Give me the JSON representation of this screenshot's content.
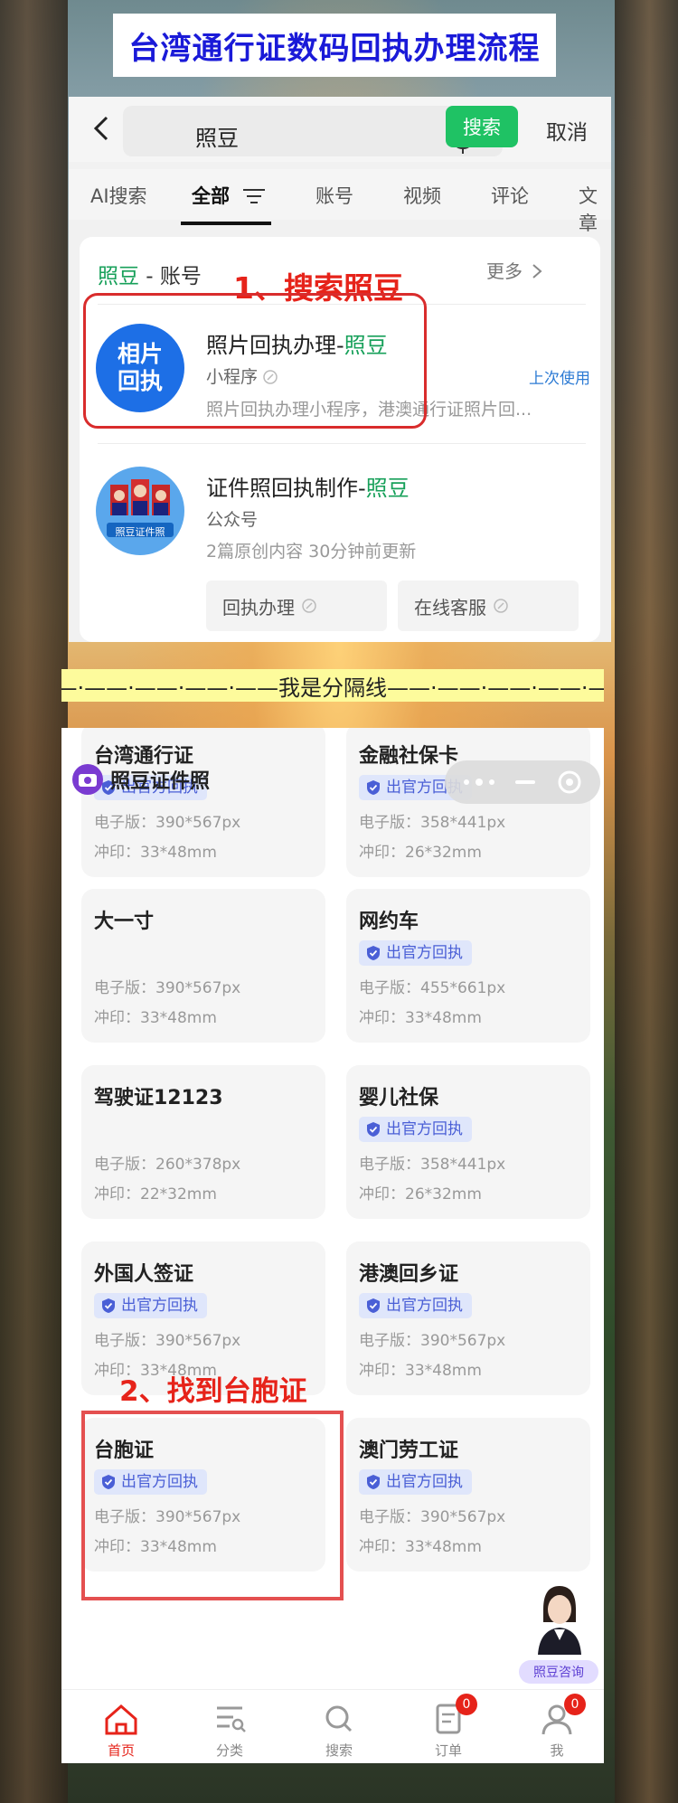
{
  "banner": {
    "title": "台湾通行证数码回执办理流程"
  },
  "search_screen": {
    "query": "照豆",
    "search_button": "搜索",
    "cancel_button": "取消",
    "tabs": [
      {
        "label": "AI搜索"
      },
      {
        "label": "全部"
      },
      {
        "label": "账号"
      },
      {
        "label": "视频"
      },
      {
        "label": "评论"
      },
      {
        "label": "文章"
      }
    ],
    "section": {
      "keyword": "照豆",
      "suffix": " - 账号",
      "more": "更多"
    },
    "annotation": "1、搜索照豆",
    "results": [
      {
        "avatar_text": "相片回执",
        "title_prefix": "照片回执办理-",
        "title_highlight": "照豆",
        "type": "小程序",
        "recent": "上次使用",
        "desc": "照片回执办理小程序，港澳通行证照片回..."
      },
      {
        "avatar_caption": "照豆证件照",
        "title_prefix": "证件照回执制作-",
        "title_highlight": "照豆",
        "type": "公众号",
        "desc": "2篇原创内容   30分钟前更新",
        "actions": [
          "回执办理",
          "在线客服"
        ]
      }
    ]
  },
  "separator": {
    "text": "——·——·——·——·——我是分隔线——·——·——·——·——"
  },
  "miniapp": {
    "name": "照豆证件照",
    "annotation": "2、找到台胞证",
    "badge_label": "出官方回执",
    "tiles": [
      {
        "name": "台湾通行证",
        "badge": true,
        "pixels": "电子版：390*567px",
        "print": "冲印：33*48mm"
      },
      {
        "name": "金融社保卡",
        "badge": true,
        "pixels": "电子版：358*441px",
        "print": "冲印：26*32mm"
      },
      {
        "name": "大一寸",
        "badge": false,
        "pixels": "电子版：390*567px",
        "print": "冲印：33*48mm"
      },
      {
        "name": "网约车",
        "badge": true,
        "pixels": "电子版：455*661px",
        "print": "冲印：33*48mm"
      },
      {
        "name": "驾驶证12123",
        "badge": false,
        "pixels": "电子版：260*378px",
        "print": "冲印：22*32mm"
      },
      {
        "name": "婴儿社保",
        "badge": true,
        "pixels": "电子版：358*441px",
        "print": "冲印：26*32mm"
      },
      {
        "name": "外国人签证",
        "badge": true,
        "pixels": "电子版：390*567px",
        "print": "冲印：33*48mm"
      },
      {
        "name": "港澳回乡证",
        "badge": true,
        "pixels": "电子版：390*567px",
        "print": "冲印：33*48mm"
      },
      {
        "name": "台胞证",
        "badge": true,
        "pixels": "电子版：390*567px",
        "print": "冲印：33*48mm"
      },
      {
        "name": "澳门劳工证",
        "badge": true,
        "pixels": "电子版：390*567px",
        "print": "冲印：33*48mm"
      }
    ],
    "consult_label": "照豆咨询",
    "nav": [
      {
        "label": "首页",
        "icon": "home-icon",
        "badge": ""
      },
      {
        "label": "分类",
        "icon": "category-icon",
        "badge": ""
      },
      {
        "label": "搜索",
        "icon": "search-icon",
        "badge": ""
      },
      {
        "label": "订单",
        "icon": "order-icon",
        "badge": "0"
      },
      {
        "label": "我",
        "icon": "profile-icon",
        "badge": "0"
      }
    ]
  },
  "colors": {
    "title_blue": "#1a1ad8",
    "wechat_green": "#1fc264",
    "highlight_green": "#17a05a",
    "annotation_red": "#e6231a",
    "badge_blue": "#4a5fd6",
    "separator_yellow": "#fdfb9c"
  }
}
